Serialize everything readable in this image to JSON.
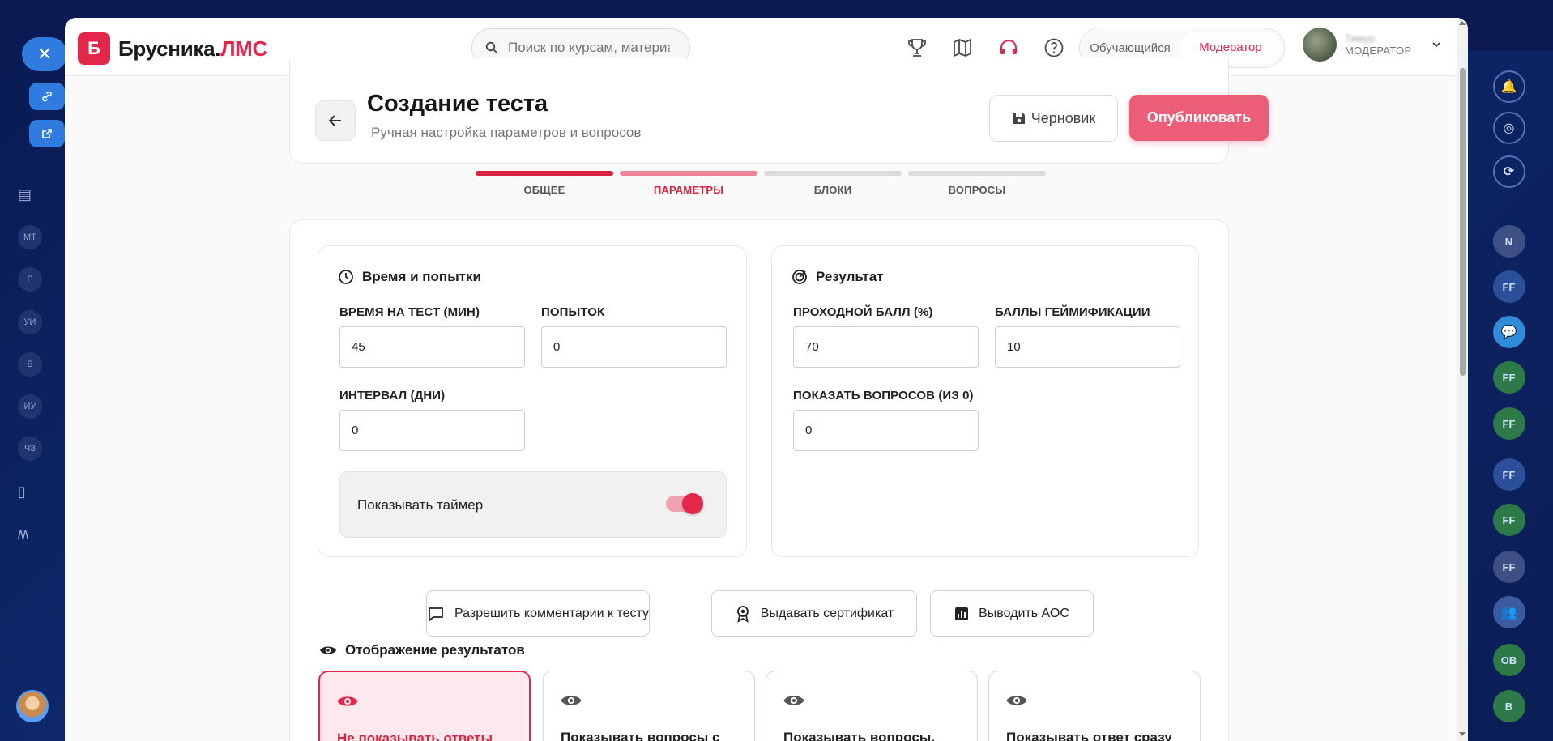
{
  "background": {
    "left_bubbles": [
      "МТ",
      "Р",
      "УИ",
      "Б",
      "ИУ",
      "ЧЗ"
    ],
    "right_avatars": [
      "N",
      "FF",
      "FF",
      "FF",
      "FF",
      "FF",
      "ОВ",
      "В"
    ]
  },
  "brand": {
    "mark": "Б",
    "name": "Брусника.",
    "accent": "ЛМС",
    "color": "#e4264a"
  },
  "search": {
    "placeholder": "Поиск по курсам, материалам"
  },
  "header_icons": [
    "trophy-icon",
    "map-icon",
    "support-icon",
    "help-icon"
  ],
  "roles": {
    "learner": "Обучающийся",
    "moderator": "Модератор",
    "active": "moderator"
  },
  "user": {
    "name": "Тимур",
    "role": "МОДЕРАТОР"
  },
  "page": {
    "title": "Создание теста",
    "subtitle": "Ручная настройка параметров и вопросов",
    "draft_label": "Черновик",
    "publish_label": "Опубликовать"
  },
  "steps": [
    {
      "label": "ОБЩЕЕ",
      "state": "done"
    },
    {
      "label": "ПАРАМЕТРЫ",
      "state": "current"
    },
    {
      "label": "БЛОКИ",
      "state": "todo"
    },
    {
      "label": "ВОПРОСЫ",
      "state": "todo"
    }
  ],
  "time_panel": {
    "title": "Время и попытки",
    "time_label": "ВРЕМЯ НА ТЕСТ (МИН)",
    "time_value": "45",
    "attempts_label": "ПОПЫТОК",
    "attempts_value": "0",
    "interval_label": "ИНТЕРВАЛ (ДНИ)",
    "interval_value": "0",
    "timer_label": "Показывать таймер",
    "timer_on": true
  },
  "result_panel": {
    "title": "Результат",
    "pass_label": "ПРОХОДНОЙ БАЛЛ (%)",
    "pass_value": "70",
    "gamification_label": "БАЛЛЫ ГЕЙМИФИКАЦИИ",
    "gamification_value": "10",
    "show_questions_label": "ПОКАЗАТЬ ВОПРОСОВ (ИЗ 0)",
    "show_questions_value": "0"
  },
  "options": {
    "comments": "Разрешить комментарии к тесту",
    "certificate": "Выдавать сертификат",
    "aos": "Выводить АОС"
  },
  "results_display": {
    "title": "Отображение результатов",
    "cards": [
      {
        "label": "Не показывать ответы",
        "selected": true
      },
      {
        "label": "Показывать вопросы с",
        "selected": false
      },
      {
        "label": "Показывать вопросы,",
        "selected": false
      },
      {
        "label": "Показывать ответ сразу",
        "selected": false
      }
    ]
  }
}
